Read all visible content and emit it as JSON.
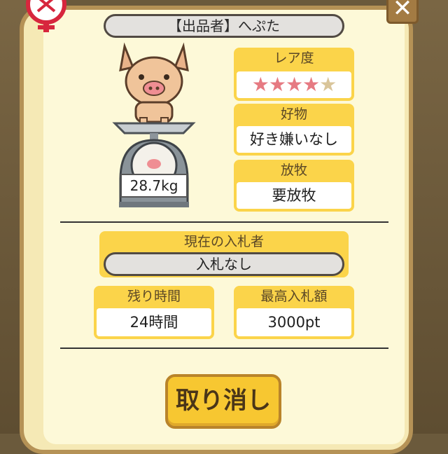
{
  "seller_label": "【出品者】へぷた",
  "pig": {
    "weight": "28.7kg"
  },
  "rarity": {
    "label": "レア度",
    "stars_filled": 4,
    "stars_total": 5
  },
  "favorite": {
    "label": "好物",
    "value": "好き嫌いなし"
  },
  "grazing": {
    "label": "放牧",
    "value": "要放牧"
  },
  "current_bidder": {
    "label": "現在の入札者",
    "value": "入札なし"
  },
  "time_left": {
    "label": "残り時間",
    "value": "24時間"
  },
  "max_bid": {
    "label": "最高入札額",
    "value": "3000pt"
  },
  "cancel_label": "取り消し",
  "close_glyph": "✕",
  "colors": {
    "accent": "#fbd44a",
    "panel": "#fdf9d8",
    "button": "#f7c731"
  }
}
